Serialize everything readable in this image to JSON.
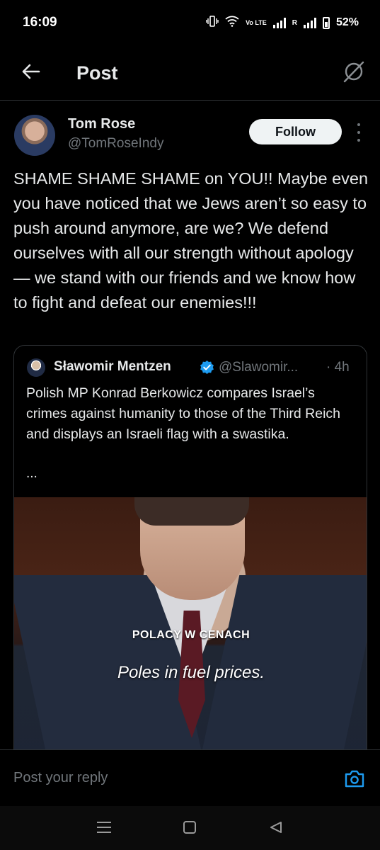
{
  "status_bar": {
    "time": "16:09",
    "network_label": "Vo LTE",
    "roaming_label": "R",
    "battery_percent": "52%"
  },
  "header": {
    "title": "Post",
    "back_icon": "arrow-left-icon",
    "grok_icon": "grok-icon"
  },
  "post": {
    "author_name": "Tom Rose",
    "author_handle": "@TomRoseIndy",
    "follow_label": "Follow",
    "text": "SHAME SHAME SHAME on YOU!! Maybe even you have noticed that we Jews aren’t so easy  to push around anymore, are we? We defend ourselves with all our strength without apology — we stand with our friends and we know how to fight and defeat our enemies!!!"
  },
  "quote": {
    "author_name": "Sławomir Mentzen",
    "author_handle": "@Slawomir...",
    "time": "· 4h",
    "text": "Polish MP Konrad Berkowicz compares Israel’s crimes against humanity to those of the Third Reich and displays an Israeli flag with a swastika.",
    "ellipsis": "...",
    "video_caption_top": "POLACY W CENACH",
    "video_caption_bottom": "Poles in fuel prices."
  },
  "reply": {
    "placeholder": "Post your reply"
  },
  "colors": {
    "background": "#000000",
    "accent": "#1d9bf0",
    "secondary_text": "#71767b"
  }
}
